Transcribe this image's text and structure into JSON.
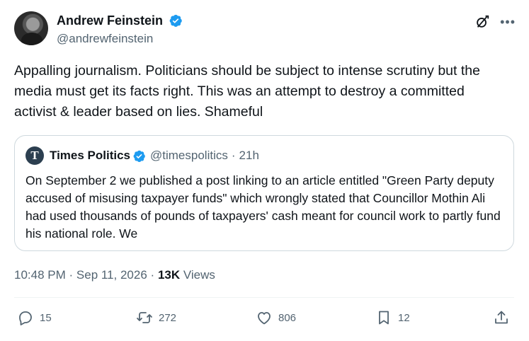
{
  "author": {
    "display_name": "Andrew Feinstein",
    "handle": "@andrewfeinstein"
  },
  "tweet": {
    "text": "Appalling journalism. Politicians should be subject to intense scrutiny but the media must get its facts right. This was an attempt to destroy a committed activist & leader based on lies. Shameful"
  },
  "quoted": {
    "avatar_letter": "T",
    "display_name": "Times Politics",
    "handle": "@timespolitics",
    "separator": "·",
    "time": "21h",
    "text": "On September 2 we published a post linking to an article entitled \"Green Party deputy accused of misusing taxpayer funds\" which wrongly stated that Councillor Mothin Ali had used thousands of pounds of taxpayers' cash meant for council work to partly fund his national role. We"
  },
  "meta": {
    "time": "10:48 PM",
    "date": "Sep 11, 2026",
    "separator": "·",
    "views_count": "13K",
    "views_label": "Views"
  },
  "actions": {
    "replies": "15",
    "reposts": "272",
    "likes": "806",
    "bookmarks": "12"
  },
  "colors": {
    "verified": "#1d9bf0",
    "secondary_text": "#536471",
    "border": "#cfd9de"
  },
  "icons": [
    "verified-badge-icon",
    "grok-icon",
    "more-icon",
    "reply-icon",
    "repost-icon",
    "like-icon",
    "bookmark-icon",
    "share-icon"
  ]
}
